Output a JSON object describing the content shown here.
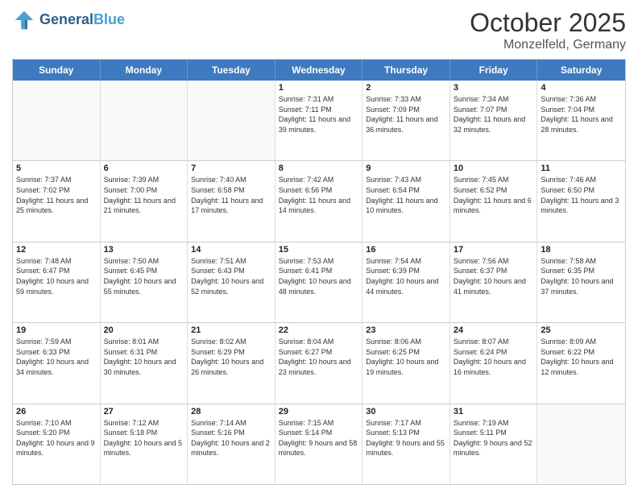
{
  "header": {
    "logo_general": "General",
    "logo_blue": "Blue",
    "month_title": "October 2025",
    "location": "Monzelfeld, Germany"
  },
  "day_headers": [
    "Sunday",
    "Monday",
    "Tuesday",
    "Wednesday",
    "Thursday",
    "Friday",
    "Saturday"
  ],
  "weeks": [
    [
      {
        "day": "",
        "empty": true
      },
      {
        "day": "",
        "empty": true
      },
      {
        "day": "",
        "empty": true
      },
      {
        "day": "1",
        "sunrise": "Sunrise: 7:31 AM",
        "sunset": "Sunset: 7:11 PM",
        "daylight": "Daylight: 11 hours and 39 minutes."
      },
      {
        "day": "2",
        "sunrise": "Sunrise: 7:33 AM",
        "sunset": "Sunset: 7:09 PM",
        "daylight": "Daylight: 11 hours and 36 minutes."
      },
      {
        "day": "3",
        "sunrise": "Sunrise: 7:34 AM",
        "sunset": "Sunset: 7:07 PM",
        "daylight": "Daylight: 11 hours and 32 minutes."
      },
      {
        "day": "4",
        "sunrise": "Sunrise: 7:36 AM",
        "sunset": "Sunset: 7:04 PM",
        "daylight": "Daylight: 11 hours and 28 minutes."
      }
    ],
    [
      {
        "day": "5",
        "sunrise": "Sunrise: 7:37 AM",
        "sunset": "Sunset: 7:02 PM",
        "daylight": "Daylight: 11 hours and 25 minutes."
      },
      {
        "day": "6",
        "sunrise": "Sunrise: 7:39 AM",
        "sunset": "Sunset: 7:00 PM",
        "daylight": "Daylight: 11 hours and 21 minutes."
      },
      {
        "day": "7",
        "sunrise": "Sunrise: 7:40 AM",
        "sunset": "Sunset: 6:58 PM",
        "daylight": "Daylight: 11 hours and 17 minutes."
      },
      {
        "day": "8",
        "sunrise": "Sunrise: 7:42 AM",
        "sunset": "Sunset: 6:56 PM",
        "daylight": "Daylight: 11 hours and 14 minutes."
      },
      {
        "day": "9",
        "sunrise": "Sunrise: 7:43 AM",
        "sunset": "Sunset: 6:54 PM",
        "daylight": "Daylight: 11 hours and 10 minutes."
      },
      {
        "day": "10",
        "sunrise": "Sunrise: 7:45 AM",
        "sunset": "Sunset: 6:52 PM",
        "daylight": "Daylight: 11 hours and 6 minutes."
      },
      {
        "day": "11",
        "sunrise": "Sunrise: 7:46 AM",
        "sunset": "Sunset: 6:50 PM",
        "daylight": "Daylight: 11 hours and 3 minutes."
      }
    ],
    [
      {
        "day": "12",
        "sunrise": "Sunrise: 7:48 AM",
        "sunset": "Sunset: 6:47 PM",
        "daylight": "Daylight: 10 hours and 59 minutes."
      },
      {
        "day": "13",
        "sunrise": "Sunrise: 7:50 AM",
        "sunset": "Sunset: 6:45 PM",
        "daylight": "Daylight: 10 hours and 55 minutes."
      },
      {
        "day": "14",
        "sunrise": "Sunrise: 7:51 AM",
        "sunset": "Sunset: 6:43 PM",
        "daylight": "Daylight: 10 hours and 52 minutes."
      },
      {
        "day": "15",
        "sunrise": "Sunrise: 7:53 AM",
        "sunset": "Sunset: 6:41 PM",
        "daylight": "Daylight: 10 hours and 48 minutes."
      },
      {
        "day": "16",
        "sunrise": "Sunrise: 7:54 AM",
        "sunset": "Sunset: 6:39 PM",
        "daylight": "Daylight: 10 hours and 44 minutes."
      },
      {
        "day": "17",
        "sunrise": "Sunrise: 7:56 AM",
        "sunset": "Sunset: 6:37 PM",
        "daylight": "Daylight: 10 hours and 41 minutes."
      },
      {
        "day": "18",
        "sunrise": "Sunrise: 7:58 AM",
        "sunset": "Sunset: 6:35 PM",
        "daylight": "Daylight: 10 hours and 37 minutes."
      }
    ],
    [
      {
        "day": "19",
        "sunrise": "Sunrise: 7:59 AM",
        "sunset": "Sunset: 6:33 PM",
        "daylight": "Daylight: 10 hours and 34 minutes."
      },
      {
        "day": "20",
        "sunrise": "Sunrise: 8:01 AM",
        "sunset": "Sunset: 6:31 PM",
        "daylight": "Daylight: 10 hours and 30 minutes."
      },
      {
        "day": "21",
        "sunrise": "Sunrise: 8:02 AM",
        "sunset": "Sunset: 6:29 PM",
        "daylight": "Daylight: 10 hours and 26 minutes."
      },
      {
        "day": "22",
        "sunrise": "Sunrise: 8:04 AM",
        "sunset": "Sunset: 6:27 PM",
        "daylight": "Daylight: 10 hours and 23 minutes."
      },
      {
        "day": "23",
        "sunrise": "Sunrise: 8:06 AM",
        "sunset": "Sunset: 6:25 PM",
        "daylight": "Daylight: 10 hours and 19 minutes."
      },
      {
        "day": "24",
        "sunrise": "Sunrise: 8:07 AM",
        "sunset": "Sunset: 6:24 PM",
        "daylight": "Daylight: 10 hours and 16 minutes."
      },
      {
        "day": "25",
        "sunrise": "Sunrise: 8:09 AM",
        "sunset": "Sunset: 6:22 PM",
        "daylight": "Daylight: 10 hours and 12 minutes."
      }
    ],
    [
      {
        "day": "26",
        "sunrise": "Sunrise: 7:10 AM",
        "sunset": "Sunset: 5:20 PM",
        "daylight": "Daylight: 10 hours and 9 minutes."
      },
      {
        "day": "27",
        "sunrise": "Sunrise: 7:12 AM",
        "sunset": "Sunset: 5:18 PM",
        "daylight": "Daylight: 10 hours and 5 minutes."
      },
      {
        "day": "28",
        "sunrise": "Sunrise: 7:14 AM",
        "sunset": "Sunset: 5:16 PM",
        "daylight": "Daylight: 10 hours and 2 minutes."
      },
      {
        "day": "29",
        "sunrise": "Sunrise: 7:15 AM",
        "sunset": "Sunset: 5:14 PM",
        "daylight": "Daylight: 9 hours and 58 minutes."
      },
      {
        "day": "30",
        "sunrise": "Sunrise: 7:17 AM",
        "sunset": "Sunset: 5:13 PM",
        "daylight": "Daylight: 9 hours and 55 minutes."
      },
      {
        "day": "31",
        "sunrise": "Sunrise: 7:19 AM",
        "sunset": "Sunset: 5:11 PM",
        "daylight": "Daylight: 9 hours and 52 minutes."
      },
      {
        "day": "",
        "empty": true
      }
    ]
  ]
}
